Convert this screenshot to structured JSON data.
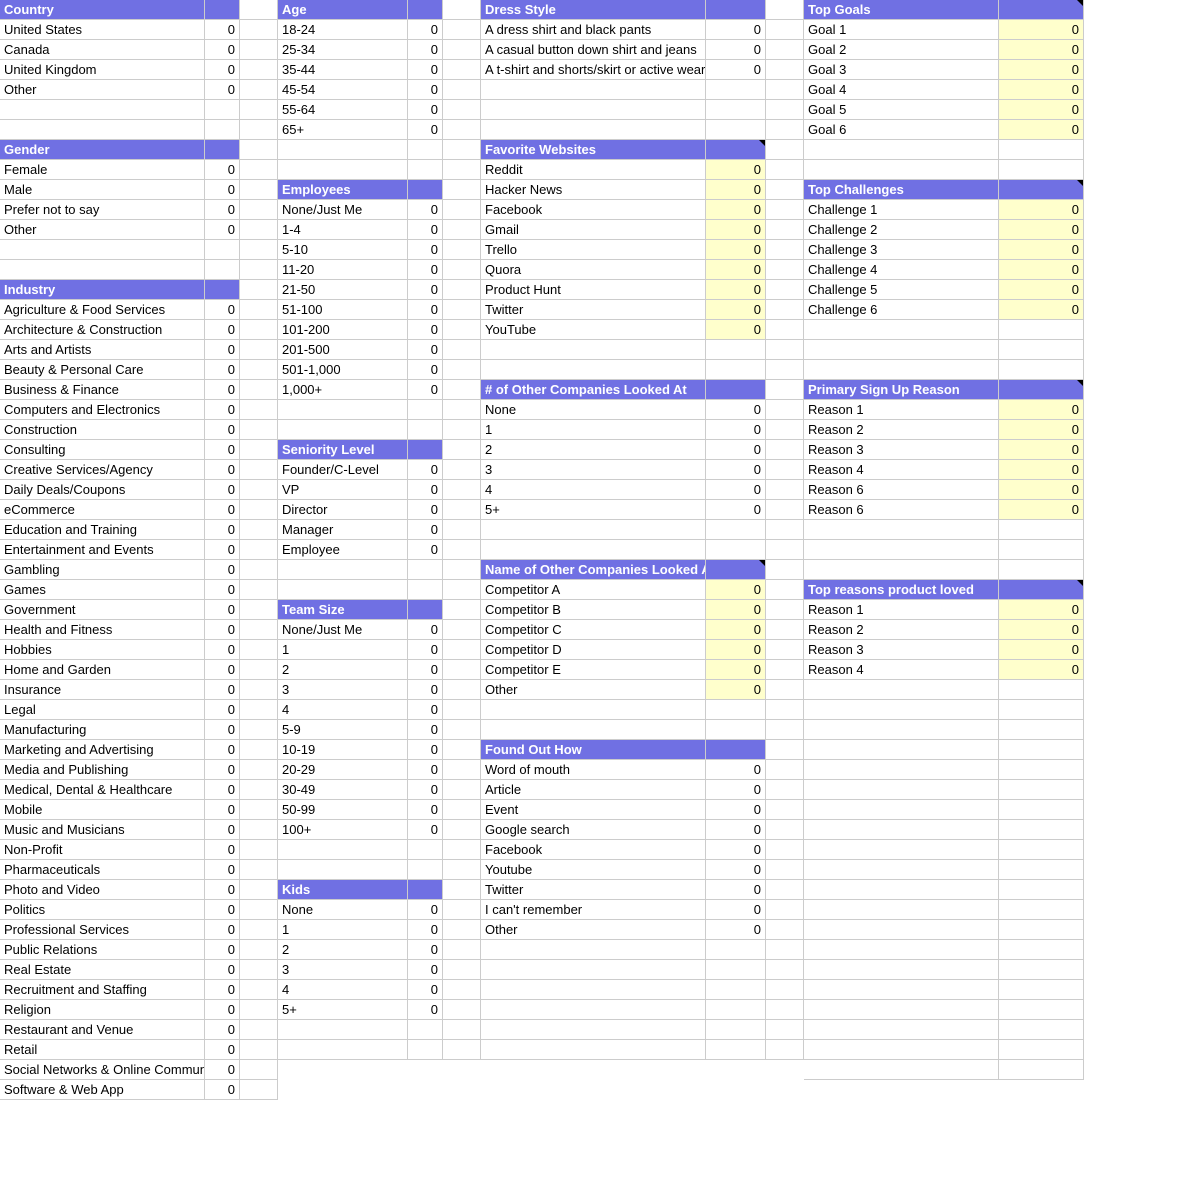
{
  "col1": {
    "sections": [
      {
        "title": "Country",
        "rows": [
          {
            "label": "United States",
            "value": 0
          },
          {
            "label": "Canada",
            "value": 0
          },
          {
            "label": "United Kingdom",
            "value": 0
          },
          {
            "label": "Other",
            "value": 0
          },
          {
            "label": "",
            "value": ""
          },
          {
            "label": "",
            "value": ""
          }
        ]
      },
      {
        "title": "Gender",
        "rows": [
          {
            "label": "Female",
            "value": 0
          },
          {
            "label": "Male",
            "value": 0
          },
          {
            "label": "Prefer not to say",
            "value": 0
          },
          {
            "label": "Other",
            "value": 0
          },
          {
            "label": "",
            "value": ""
          },
          {
            "label": "",
            "value": ""
          }
        ]
      },
      {
        "title": "Industry",
        "rows": [
          {
            "label": "Agriculture & Food Services",
            "value": 0
          },
          {
            "label": "Architecture & Construction",
            "value": 0
          },
          {
            "label": "Arts and Artists",
            "value": 0
          },
          {
            "label": "Beauty & Personal Care",
            "value": 0
          },
          {
            "label": "Business & Finance",
            "value": 0
          },
          {
            "label": "Computers and Electronics",
            "value": 0
          },
          {
            "label": "Construction",
            "value": 0
          },
          {
            "label": "Consulting",
            "value": 0
          },
          {
            "label": "Creative Services/Agency",
            "value": 0
          },
          {
            "label": "Daily Deals/Coupons",
            "value": 0
          },
          {
            "label": "eCommerce",
            "value": 0
          },
          {
            "label": "Education and Training",
            "value": 0
          },
          {
            "label": "Entertainment and Events",
            "value": 0
          },
          {
            "label": "Gambling",
            "value": 0
          },
          {
            "label": "Games",
            "value": 0
          },
          {
            "label": "Government",
            "value": 0
          },
          {
            "label": "Health and Fitness",
            "value": 0
          },
          {
            "label": "Hobbies",
            "value": 0
          },
          {
            "label": "Home and Garden",
            "value": 0
          },
          {
            "label": "Insurance",
            "value": 0
          },
          {
            "label": "Legal",
            "value": 0
          },
          {
            "label": "Manufacturing",
            "value": 0
          },
          {
            "label": "Marketing and Advertising",
            "value": 0
          },
          {
            "label": "Media and Publishing",
            "value": 0
          },
          {
            "label": "Medical, Dental & Healthcare",
            "value": 0
          },
          {
            "label": "Mobile",
            "value": 0
          },
          {
            "label": "Music and Musicians",
            "value": 0
          },
          {
            "label": "Non-Profit",
            "value": 0
          },
          {
            "label": "Pharmaceuticals",
            "value": 0
          },
          {
            "label": "Photo and Video",
            "value": 0
          },
          {
            "label": "Politics",
            "value": 0
          },
          {
            "label": "Professional Services",
            "value": 0
          },
          {
            "label": "Public Relations",
            "value": 0
          },
          {
            "label": "Real Estate",
            "value": 0
          },
          {
            "label": "Recruitment and Staffing",
            "value": 0
          },
          {
            "label": "Religion",
            "value": 0
          },
          {
            "label": "Restaurant and Venue",
            "value": 0
          },
          {
            "label": "Retail",
            "value": 0
          },
          {
            "label": "Social Networks & Online Communities",
            "value": 0
          },
          {
            "label": "Software & Web App",
            "value": 0
          }
        ]
      }
    ]
  },
  "col2": {
    "sections": [
      {
        "title": "Age",
        "rows": [
          {
            "label": "18-24",
            "value": 0
          },
          {
            "label": "25-34",
            "value": 0
          },
          {
            "label": "35-44",
            "value": 0
          },
          {
            "label": "45-54",
            "value": 0
          },
          {
            "label": "55-64",
            "value": 0
          },
          {
            "label": "65+",
            "value": 0
          },
          {
            "label": "",
            "value": ""
          },
          {
            "label": "",
            "value": ""
          }
        ]
      },
      {
        "title": "Employees",
        "rows": [
          {
            "label": "None/Just Me",
            "value": 0
          },
          {
            "label": "1-4",
            "value": 0
          },
          {
            "label": "5-10",
            "value": 0
          },
          {
            "label": "11-20",
            "value": 0
          },
          {
            "label": "21-50",
            "value": 0
          },
          {
            "label": "51-100",
            "value": 0
          },
          {
            "label": "101-200",
            "value": 0
          },
          {
            "label": "201-500",
            "value": 0
          },
          {
            "label": "501-1,000",
            "value": 0
          },
          {
            "label": "1,000+",
            "value": 0
          },
          {
            "label": "",
            "value": ""
          },
          {
            "label": "",
            "value": ""
          }
        ]
      },
      {
        "title": "Seniority Level",
        "rows": [
          {
            "label": "Founder/C-Level",
            "value": 0
          },
          {
            "label": "VP",
            "value": 0
          },
          {
            "label": "Director",
            "value": 0
          },
          {
            "label": "Manager",
            "value": 0
          },
          {
            "label": "Employee",
            "value": 0
          },
          {
            "label": "",
            "value": ""
          },
          {
            "label": "",
            "value": ""
          }
        ]
      },
      {
        "title": "Team Size",
        "rows": [
          {
            "label": "None/Just Me",
            "value": 0
          },
          {
            "label": "1",
            "value": 0
          },
          {
            "label": "2",
            "value": 0
          },
          {
            "label": "3",
            "value": 0
          },
          {
            "label": "4",
            "value": 0
          },
          {
            "label": "5-9",
            "value": 0
          },
          {
            "label": "10-19",
            "value": 0
          },
          {
            "label": "20-29",
            "value": 0
          },
          {
            "label": "30-49",
            "value": 0
          },
          {
            "label": "50-99",
            "value": 0
          },
          {
            "label": "100+",
            "value": 0
          },
          {
            "label": "",
            "value": ""
          },
          {
            "label": "",
            "value": ""
          }
        ]
      },
      {
        "title": "Kids",
        "rows": [
          {
            "label": "None",
            "value": 0
          },
          {
            "label": "1",
            "value": 0
          },
          {
            "label": "2",
            "value": 0
          },
          {
            "label": "3",
            "value": 0
          },
          {
            "label": "4",
            "value": 0
          },
          {
            "label": "5+",
            "value": 0
          },
          {
            "label": "",
            "value": ""
          },
          {
            "label": "",
            "value": ""
          }
        ]
      }
    ]
  },
  "col3": {
    "sections": [
      {
        "title": "Dress Style",
        "highlight": false,
        "rows": [
          {
            "label": "A dress shirt and black pants",
            "value": 0
          },
          {
            "label": "A casual button down shirt and jeans",
            "value": 0
          },
          {
            "label": "A t-shirt and shorts/skirt or active wear",
            "value": 0
          },
          {
            "label": "",
            "value": ""
          },
          {
            "label": "",
            "value": ""
          },
          {
            "label": "",
            "value": ""
          }
        ]
      },
      {
        "title": "Favorite Websites",
        "highlight": true,
        "note": true,
        "rows": [
          {
            "label": "Reddit",
            "value": 0
          },
          {
            "label": "Hacker News",
            "value": 0
          },
          {
            "label": "Facebook",
            "value": 0
          },
          {
            "label": "Gmail",
            "value": 0
          },
          {
            "label": "Trello",
            "value": 0
          },
          {
            "label": "Quora",
            "value": 0
          },
          {
            "label": "Product Hunt",
            "value": 0
          },
          {
            "label": "Twitter",
            "value": 0
          },
          {
            "label": "YouTube",
            "value": 0
          },
          {
            "label": "",
            "value": ""
          },
          {
            "label": "",
            "value": ""
          }
        ]
      },
      {
        "title": "# of Other Companies Looked At",
        "highlight": false,
        "rows": [
          {
            "label": "None",
            "value": 0
          },
          {
            "label": "1",
            "value": 0
          },
          {
            "label": "2",
            "value": 0
          },
          {
            "label": "3",
            "value": 0
          },
          {
            "label": "4",
            "value": 0
          },
          {
            "label": "5+",
            "value": 0
          },
          {
            "label": "",
            "value": ""
          },
          {
            "label": "",
            "value": ""
          }
        ]
      },
      {
        "title": "Name of  Other Companies Looked At",
        "highlight": true,
        "note": true,
        "rows": [
          {
            "label": "Competitor A",
            "value": 0
          },
          {
            "label": "Competitor B",
            "value": 0
          },
          {
            "label": "Competitor C",
            "value": 0
          },
          {
            "label": "Competitor D",
            "value": 0
          },
          {
            "label": "Competitor E",
            "value": 0
          },
          {
            "label": "Other",
            "value": 0
          },
          {
            "label": "",
            "value": ""
          },
          {
            "label": "",
            "value": ""
          }
        ]
      },
      {
        "title": "Found Out How",
        "highlight": false,
        "rows": [
          {
            "label": "Word of mouth",
            "value": 0
          },
          {
            "label": "Article",
            "value": 0
          },
          {
            "label": "Event",
            "value": 0
          },
          {
            "label": "Google search",
            "value": 0
          },
          {
            "label": "Facebook",
            "value": 0
          },
          {
            "label": "Youtube",
            "value": 0
          },
          {
            "label": "Twitter",
            "value": 0
          },
          {
            "label": "I can't remember",
            "value": 0
          },
          {
            "label": "Other",
            "value": 0
          },
          {
            "label": "",
            "value": ""
          },
          {
            "label": "",
            "value": ""
          },
          {
            "label": "",
            "value": ""
          },
          {
            "label": "",
            "value": ""
          },
          {
            "label": "",
            "value": ""
          },
          {
            "label": "",
            "value": ""
          }
        ]
      }
    ]
  },
  "col4": {
    "sections": [
      {
        "title": "Top Goals",
        "highlight": true,
        "note": true,
        "rows": [
          {
            "label": "Goal 1",
            "value": 0
          },
          {
            "label": "Goal 2",
            "value": 0
          },
          {
            "label": "Goal 3",
            "value": 0
          },
          {
            "label": "Goal 4",
            "value": 0
          },
          {
            "label": "Goal 5",
            "value": 0
          },
          {
            "label": "Goal 6",
            "value": 0
          },
          {
            "label": "",
            "value": ""
          },
          {
            "label": "",
            "value": ""
          }
        ]
      },
      {
        "title": "Top Challenges",
        "highlight": true,
        "note": true,
        "rows": [
          {
            "label": "Challenge 1",
            "value": 0
          },
          {
            "label": "Challenge 2",
            "value": 0
          },
          {
            "label": "Challenge 3",
            "value": 0
          },
          {
            "label": "Challenge 4",
            "value": 0
          },
          {
            "label": "Challenge 5",
            "value": 0
          },
          {
            "label": "Challenge 6",
            "value": 0
          },
          {
            "label": "",
            "value": ""
          },
          {
            "label": "",
            "value": ""
          },
          {
            "label": "",
            "value": ""
          }
        ]
      },
      {
        "title": "Primary Sign Up Reason",
        "highlight": true,
        "note": true,
        "rows": [
          {
            "label": "Reason 1",
            "value": 0
          },
          {
            "label": "Reason 2",
            "value": 0
          },
          {
            "label": "Reason 3",
            "value": 0
          },
          {
            "label": "Reason 4",
            "value": 0
          },
          {
            "label": "Reason 6",
            "value": 0
          },
          {
            "label": "Reason 6",
            "value": 0
          },
          {
            "label": "",
            "value": ""
          },
          {
            "label": "",
            "value": ""
          },
          {
            "label": "",
            "value": ""
          }
        ]
      },
      {
        "title": "Top reasons product loved",
        "highlight": true,
        "note": true,
        "rows": [
          {
            "label": "Reason 1",
            "value": 0
          },
          {
            "label": "Reason 2",
            "value": 0
          },
          {
            "label": "Reason 3",
            "value": 0
          },
          {
            "label": "Reason 4",
            "value": 0
          },
          {
            "label": "",
            "value": ""
          },
          {
            "label": "",
            "value": ""
          },
          {
            "label": "",
            "value": ""
          },
          {
            "label": "",
            "value": ""
          },
          {
            "label": "",
            "value": ""
          },
          {
            "label": "",
            "value": ""
          },
          {
            "label": "",
            "value": ""
          },
          {
            "label": "",
            "value": ""
          },
          {
            "label": "",
            "value": ""
          },
          {
            "label": "",
            "value": ""
          },
          {
            "label": "",
            "value": ""
          },
          {
            "label": "",
            "value": ""
          },
          {
            "label": "",
            "value": ""
          },
          {
            "label": "",
            "value": ""
          },
          {
            "label": "",
            "value": ""
          },
          {
            "label": "",
            "value": ""
          },
          {
            "label": "",
            "value": ""
          },
          {
            "label": "",
            "value": ""
          },
          {
            "label": "",
            "value": ""
          },
          {
            "label": "",
            "value": ""
          }
        ]
      }
    ]
  }
}
